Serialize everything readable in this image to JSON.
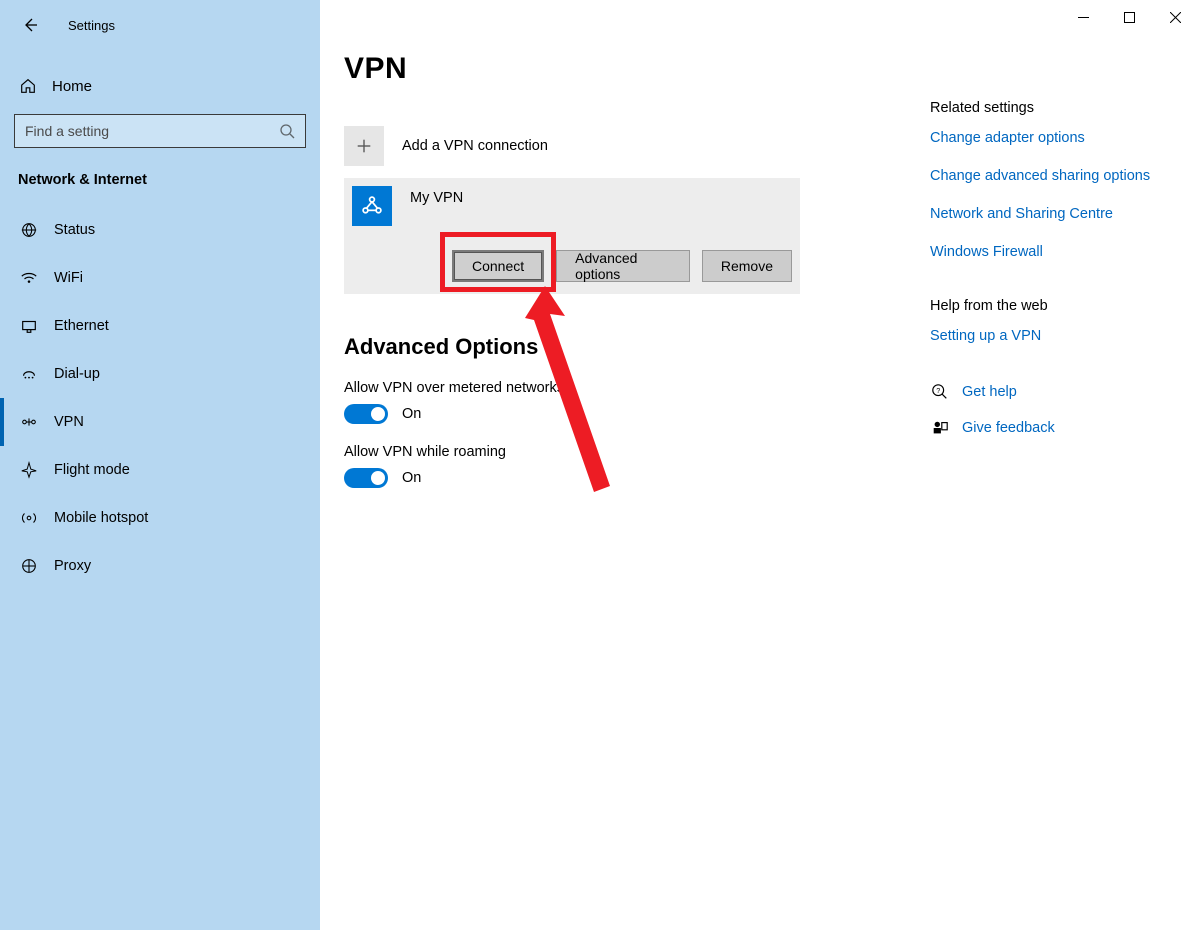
{
  "window": {
    "title": "Settings"
  },
  "sidebar": {
    "home": "Home",
    "search_placeholder": "Find a setting",
    "category": "Network & Internet",
    "items": [
      {
        "label": "Status"
      },
      {
        "label": "WiFi"
      },
      {
        "label": "Ethernet"
      },
      {
        "label": "Dial-up"
      },
      {
        "label": "VPN"
      },
      {
        "label": "Flight mode"
      },
      {
        "label": "Mobile hotspot"
      },
      {
        "label": "Proxy"
      }
    ],
    "active_index": 4
  },
  "main": {
    "title": "VPN",
    "add_label": "Add a VPN connection",
    "vpn_entry": {
      "name": "My VPN",
      "actions": {
        "connect": "Connect",
        "advanced": "Advanced options",
        "remove": "Remove"
      }
    },
    "advanced_heading": "Advanced Options",
    "opt1": {
      "label": "Allow VPN over metered networks",
      "state": "On"
    },
    "opt2": {
      "label": "Allow VPN while roaming",
      "state": "On"
    }
  },
  "right": {
    "related_heading": "Related settings",
    "links": [
      "Change adapter options",
      "Change advanced sharing options",
      "Network and Sharing Centre",
      "Windows Firewall"
    ],
    "help_heading": "Help from the web",
    "help_link": "Setting up a VPN",
    "get_help": "Get help",
    "feedback": "Give feedback"
  },
  "annotation": {
    "highlighted_button": "Connect"
  }
}
